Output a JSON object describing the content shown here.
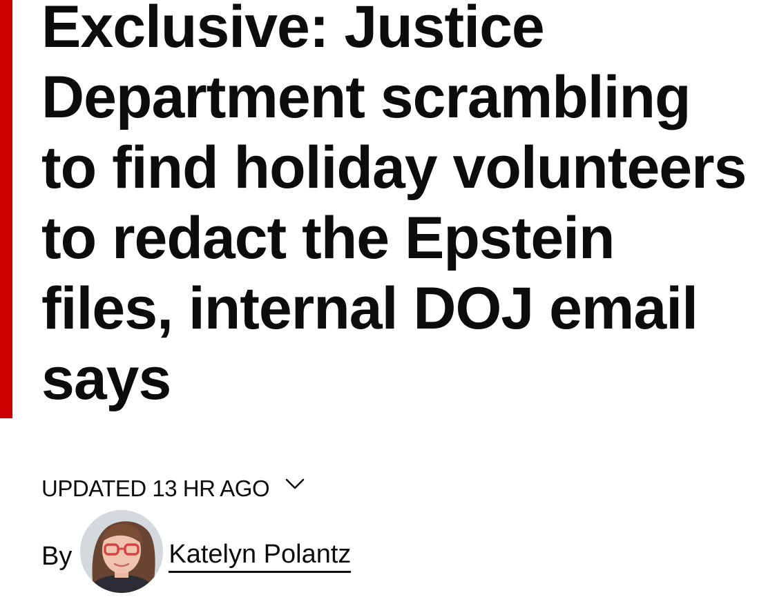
{
  "article": {
    "headline": "Exclusive: Justice Department scrambling to find holiday volunteers to redact the Epstein files, internal DOJ email says",
    "updated": "UPDATED 13 HR AGO",
    "byline_prefix": "By",
    "author_name": "Katelyn Polantz"
  },
  "icons": {
    "expand": "chevron-down-icon",
    "author_photo": "avatar"
  },
  "colors": {
    "accent": "#cc0000",
    "text": "#0c0c0c",
    "background": "#ffffff"
  }
}
